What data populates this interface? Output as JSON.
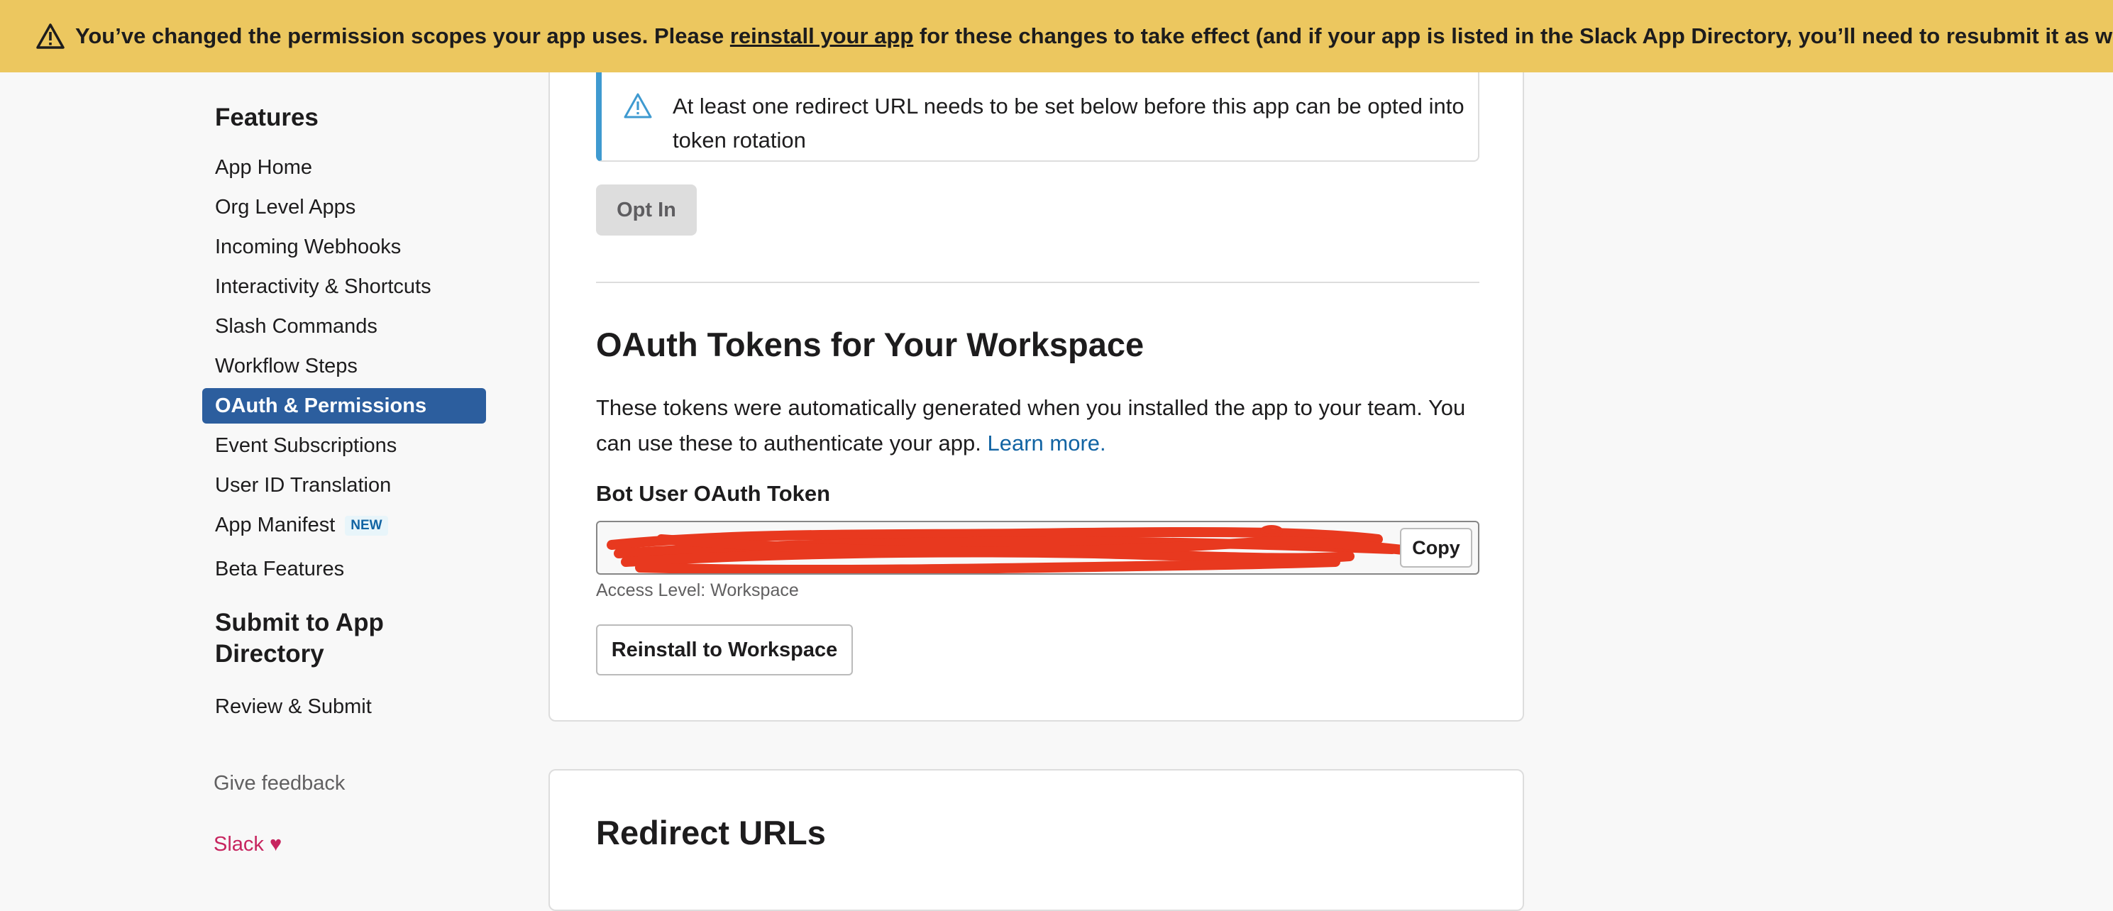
{
  "banner": {
    "text_before": "You’ve changed the permission scopes your app uses. Please ",
    "link_text": "reinstall your app",
    "text_after": " for these changes to take effect (and if your app is listed in the Slack App Directory, you’ll need to resubmit it as well).",
    "icon": "warning-icon"
  },
  "sidebar": {
    "features_heading": "Features",
    "items": [
      {
        "label": "App Home"
      },
      {
        "label": "Org Level Apps"
      },
      {
        "label": "Incoming Webhooks"
      },
      {
        "label": "Interactivity & Shortcuts"
      },
      {
        "label": "Slash Commands"
      },
      {
        "label": "Workflow Steps"
      },
      {
        "label": "OAuth & Permissions",
        "active": true
      },
      {
        "label": "Event Subscriptions"
      },
      {
        "label": "User ID Translation"
      },
      {
        "label": "App Manifest",
        "badge": "NEW"
      },
      {
        "label": "Beta Features"
      }
    ],
    "submit_heading_line1": "Submit to App",
    "submit_heading_line2": "Directory",
    "review_item": "Review & Submit",
    "feedback": "Give feedback",
    "slack_link": "Slack ♥",
    "active_color": "#2c5e9e"
  },
  "main": {
    "notice_text": "At least one redirect URL needs to be set below before this app can be opted into token rotation",
    "opt_in_button": "Opt In",
    "oauth_title": "OAuth Tokens for Your Workspace",
    "oauth_desc": "These tokens were automatically generated when you installed the app to your team. You can use these to authenticate your app. ",
    "learn_more": "Learn more.",
    "bot_token_label": "Bot User OAuth Token",
    "copy_button": "Copy",
    "access_level": "Access Level: Workspace",
    "reinstall_button": "Reinstall to Workspace",
    "redirect_title": "Redirect URLs"
  },
  "colors": {
    "banner_bg": "#ecc75f",
    "link": "#1264a3",
    "notice_accent": "#3f9ad0",
    "redaction": "#e8391f",
    "slack_heart": "#c7255f"
  }
}
